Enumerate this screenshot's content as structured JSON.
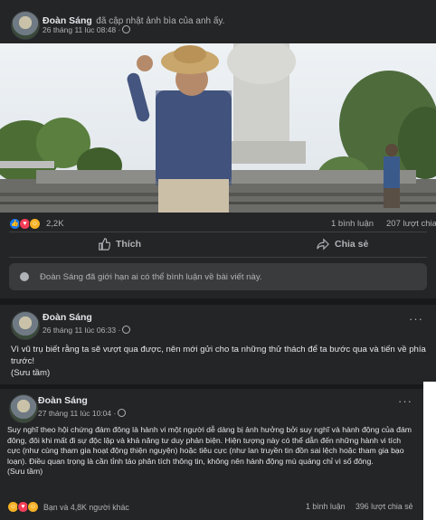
{
  "post1": {
    "author": "Đoàn Sáng",
    "action_text": "đã cập nhật ảnh bìa của anh ấy.",
    "time": "26 tháng 11 lúc 08:48 ·",
    "reactions_count": "2,2K",
    "comments": "1 bình luận",
    "shares": "207 lượt chia",
    "like_label": "Thích",
    "share_label": "Chia sẻ",
    "notice": "Đoàn Sáng đã giới hạn ai có thể bình luận về bài viết này."
  },
  "post2": {
    "author": "Đoàn Sáng",
    "time": "26 tháng 11 lúc 06:33 ·",
    "text": "Vì vũ trụ biết rằng ta sẽ vượt qua được, nên mới gửi cho ta những thử thách để ta bước qua và tiến về phía trước!",
    "source": "(Sưu tầm)"
  },
  "post3": {
    "author": "Đoàn Sáng",
    "time": "27 tháng 11 lúc 10:04 ·",
    "text": "Suy nghĩ theo hội chứng đám đông là hành vi một người dễ dàng bị ảnh hưởng bởi suy nghĩ và hành động của đám đông, đôi khi mất đi sự độc lập và khả năng tư duy phản biện. Hiện tượng này có thể dẫn đến những hành vi tích cực (như cùng tham gia hoạt động thiện nguyện) hoặc tiêu cực (như lan truyền tin đồn sai lệch hoặc tham gia bạo loạn). Điều quan trọng là cần tỉnh táo phân tích thông tin, không nên hành động mù quáng chỉ vì số đông.",
    "source": "(Sưu tầm)",
    "reactions_text": "Bạn và 4,8K người khác",
    "comments": "1 bình luận",
    "shares": "396 lượt chia sẻ"
  },
  "colors": {
    "background": "#18191a",
    "card": "#242526",
    "text_primary": "#e4e6eb",
    "text_secondary": "#b0b3b8",
    "like_blue": "#1877f2"
  }
}
